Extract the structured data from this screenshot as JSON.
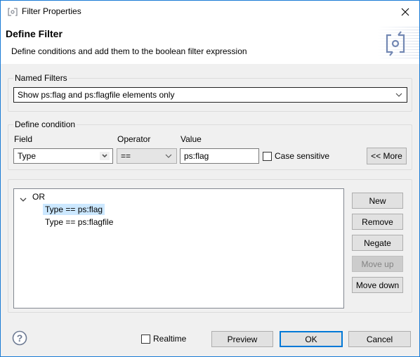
{
  "window": {
    "title": "Filter Properties",
    "icon": "filter-properties-icon",
    "close_icon": "close-icon"
  },
  "header": {
    "title": "Define Filter",
    "description": "Define conditions and add them to the boolean filter expression",
    "banner_icon": "filter-banner-icon"
  },
  "named_filters": {
    "group_label": "Named Filters",
    "selected": "Show ps:flag and ps:flagfile elements only"
  },
  "define_condition": {
    "group_label": "Define condition",
    "field_label": "Field",
    "field_value": "Type",
    "operator_label": "Operator",
    "operator_value": "==",
    "value_label": "Value",
    "value_input": "ps:flag",
    "case_sensitive_label": "Case sensitive",
    "case_sensitive_checked": false,
    "more_button": "<< More"
  },
  "expression_tree": {
    "root": {
      "label": "OR",
      "expanded": true
    },
    "children": [
      {
        "label": "Type == ps:flag",
        "selected": true
      },
      {
        "label": "Type == ps:flagfile",
        "selected": false
      }
    ]
  },
  "side_buttons": {
    "new": "New",
    "remove": "Remove",
    "negate": "Negate",
    "move_up": "Move up",
    "move_up_enabled": false,
    "move_down": "Move down"
  },
  "footer": {
    "help_icon": "help-icon",
    "realtime_label": "Realtime",
    "realtime_checked": false,
    "preview": "Preview",
    "ok": "OK",
    "cancel": "Cancel"
  },
  "colors": {
    "accent": "#0078d7",
    "window_border": "#1a7bd5",
    "selection": "#cce8ff",
    "dialog_bg": "#f0f0f0"
  }
}
